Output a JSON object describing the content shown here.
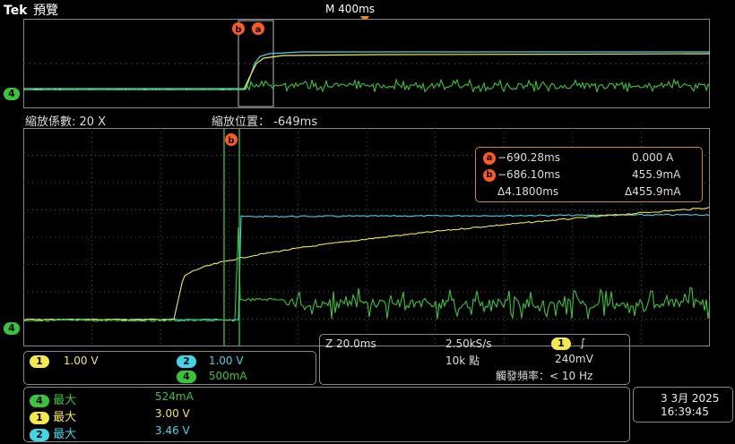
{
  "header": {
    "brand": "Tek",
    "mode": "預覽",
    "timebase": "M 400ms"
  },
  "zoom": {
    "factor_label": "縮放係數: 20 X",
    "position_label": "縮放位置：",
    "position_value": "-649ms"
  },
  "channel_markers": {
    "ch4": "4"
  },
  "cursor_labels": {
    "a": "a",
    "b": "b"
  },
  "cursor_readout": {
    "a_time": "−690.28ms",
    "a_value": "0.000 A",
    "b_time": "−686.10ms",
    "b_value": "455.9mA",
    "delta_time": "Δ4.1800ms",
    "delta_value": "Δ455.9mA"
  },
  "channels": [
    {
      "num": "1",
      "scale": "1.00 V",
      "color": "#f5e94a"
    },
    {
      "num": "2",
      "scale": "1.00 V",
      "color": "#3fd7e8"
    },
    {
      "num": "4",
      "scale": "500mA",
      "color": "#39c43c"
    }
  ],
  "acquisition": {
    "zoom_time": "Z 20.0ms",
    "sample_rate": "2.50kS/s",
    "points": "10k 點",
    "trigger_channel": "1",
    "trigger_slope": "∫",
    "trigger_level": "240mV",
    "trigger_freq": "觸發頻率：< 10 Hz"
  },
  "measurements": [
    {
      "ch": "4",
      "label": "最大",
      "value": "524mA",
      "color": "#39c43c"
    },
    {
      "ch": "1",
      "label": "最大",
      "value": "3.00 V",
      "color": "#f5e94a"
    },
    {
      "ch": "2",
      "label": "最大",
      "value": "3.46 V",
      "color": "#3fd7e8"
    }
  ],
  "datetime": {
    "date": "3 3月 2025",
    "time": "16:39:45"
  },
  "colors": {
    "ch1": "#f5e94a",
    "ch2": "#3fd7e8",
    "ch4": "#39c43c",
    "cursor": "#ff5a1f",
    "grid": "#5a5a5a"
  }
}
